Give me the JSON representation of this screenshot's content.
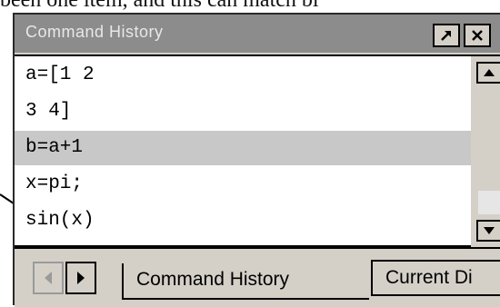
{
  "background_caption_fragment": "been one item, and this can match bi",
  "window": {
    "title": "Command History",
    "undock_button_label": "↗",
    "close_button_label": "✕"
  },
  "history": {
    "items": [
      "a=[1 2",
      "3 4]",
      "b=a+1",
      "x=pi;",
      "sin(x)"
    ],
    "selected_index": 2
  },
  "tabs": {
    "items": [
      {
        "label": "Command History",
        "active": true
      },
      {
        "label": "Current Di",
        "active": false
      }
    ]
  },
  "icons": {
    "undock": "undock-arrow-icon",
    "close": "close-icon",
    "scroll_up": "arrow-up-icon",
    "scroll_down": "arrow-down-icon",
    "tab_prev": "arrow-left-icon",
    "tab_next": "arrow-right-icon"
  },
  "colors": {
    "titlebar": "#8c8c8c",
    "panel": "#d4d0c8",
    "selection": "#c8c8c8"
  }
}
